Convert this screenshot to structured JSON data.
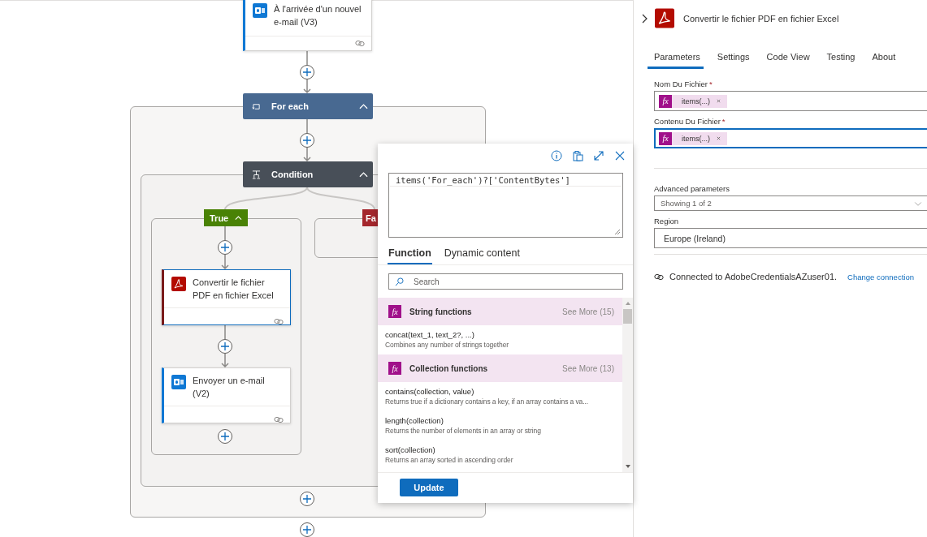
{
  "canvas": {
    "trigger": {
      "title": "À l'arrivée d'un nouvel e-mail (V3)",
      "kind": "outlook"
    },
    "for_each": {
      "title": "For each",
      "expanded": true
    },
    "condition": {
      "title": "Condition",
      "expanded": true
    },
    "true_branch": {
      "label": "True",
      "expanded": true,
      "actions": [
        {
          "title": "Convertir le fichier PDF en fichier Excel",
          "kind": "pdf",
          "selected": true
        },
        {
          "title": "Envoyer un e-mail (V2)",
          "kind": "outlook",
          "selected": false
        }
      ]
    },
    "false_branch": {
      "label": "Fa"
    }
  },
  "expression_editor": {
    "expression": "items('For_each')?['ContentBytes']",
    "tabs": [
      {
        "label": "Function",
        "selected": true
      },
      {
        "label": "Dynamic content",
        "selected": false
      }
    ],
    "search": {
      "placeholder": "Search"
    },
    "groups": [
      {
        "icon_label": "fx",
        "title": "String functions",
        "see_more": "See More (15)",
        "functions": [
          {
            "signature": "concat(text_1, text_2?, ...)",
            "description": "Combines any number of strings together"
          }
        ]
      },
      {
        "icon_label": "fx",
        "title": "Collection functions",
        "see_more": "See More (13)",
        "functions": [
          {
            "signature": "contains(collection, value)",
            "description": "Returns true if a dictionary contains a key, if an array contains a va..."
          },
          {
            "signature": "length(collection)",
            "description": "Returns the number of elements in an array or string"
          },
          {
            "signature": "sort(collection)",
            "description": "Returns an array sorted in ascending order"
          }
        ]
      }
    ],
    "button": "Update"
  },
  "panel": {
    "title": "Convertir le fichier PDF en fichier Excel",
    "tabs": [
      {
        "label": "Parameters",
        "selected": true
      },
      {
        "label": "Settings",
        "selected": false
      },
      {
        "label": "Code View",
        "selected": false
      },
      {
        "label": "Testing",
        "selected": false
      },
      {
        "label": "About",
        "selected": false
      }
    ],
    "fields": [
      {
        "label": "Nom Du Fichier",
        "required_mark": "*",
        "icon_label": "fx",
        "token": "items(...)",
        "focused": false
      },
      {
        "label": "Contenu Du Fichier",
        "required_mark": "*",
        "icon_label": "fx",
        "token": "items(...)",
        "focused": true
      }
    ],
    "advanced": {
      "label": "Advanced parameters",
      "value": "Showing 1 of 2"
    },
    "region": {
      "label": "Region",
      "value": "Europe (Ireland)"
    },
    "connection": {
      "text": "Connected to AdobeCredentialsAZuser01.",
      "link": "Change connection"
    }
  }
}
